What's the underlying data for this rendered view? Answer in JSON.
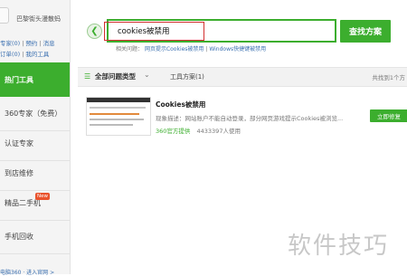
{
  "user": {
    "name": "巴黎街头漫散蚂",
    "links_row1": [
      "专家(0)",
      "预约",
      "消息"
    ],
    "links_row2": [
      "订单(0)",
      "我的工具"
    ]
  },
  "sidebar": {
    "items": [
      {
        "label": "热门工具"
      },
      {
        "label": "360专家（免费）"
      },
      {
        "label": "认证专家"
      },
      {
        "label": "到店维修"
      },
      {
        "label": "精品二手机",
        "badge": "New"
      },
      {
        "label": "手机回收"
      }
    ],
    "bottom_text": "电脑360 · 进入官网 >"
  },
  "search": {
    "value": "cookies被禁用",
    "button": "查找方案",
    "related_label": "相关问题：",
    "related_links": [
      "网页提示Cookies被禁用",
      "Windows快捷键被禁用"
    ],
    "related_sep": "|"
  },
  "toolbar": {
    "filter_label": "全部问题类型",
    "tab_tools": "工具方案(1)",
    "found_text": "共找到1个方"
  },
  "result": {
    "title": "Cookies被禁用",
    "description": "现象描述：网站账户不能自动登录，部分网页游戏提示Cookies被浏览...",
    "provider": "360官方提供",
    "users": "4433397人使用",
    "fix_button": "立即修复"
  },
  "watermark": "软件技巧",
  "icons": {
    "back": "back-arrow-icon",
    "list": "list-icon",
    "chevron": "chevron-down-icon"
  },
  "colors": {
    "accent": "#3cae2e",
    "highlight": "#d22f2f",
    "link": "#3a6fb0"
  }
}
